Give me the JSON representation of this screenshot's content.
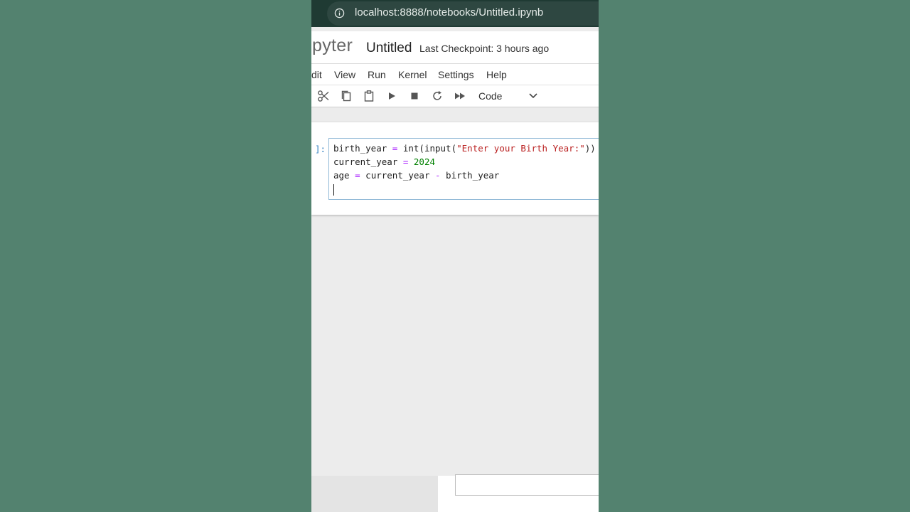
{
  "browser": {
    "url": "localhost:8888/notebooks/Untitled.ipynb"
  },
  "header": {
    "logo_text": "pyter",
    "notebook_title": "Untitled",
    "checkpoint": "Last Checkpoint: 3 hours ago"
  },
  "menu": {
    "items": [
      "dit",
      "View",
      "Run",
      "Kernel",
      "Settings",
      "Help"
    ]
  },
  "toolbar": {
    "cell_type": "Code",
    "icons": [
      "cut-icon",
      "copy-icon",
      "paste-icon",
      "run-icon",
      "stop-icon",
      "restart-icon",
      "fast-forward-icon"
    ]
  },
  "cell": {
    "prompt": "]:",
    "lines": [
      {
        "parts": [
          [
            "var",
            "birth_year "
          ],
          [
            "op",
            "="
          ],
          [
            "var",
            " int(input("
          ],
          [
            "str",
            "\"Enter your Birth Year:\""
          ],
          [
            "var",
            "))"
          ]
        ]
      },
      {
        "parts": [
          [
            "var",
            "current_year "
          ],
          [
            "op",
            "="
          ],
          [
            "var",
            " "
          ],
          [
            "num",
            "2024"
          ]
        ]
      },
      {
        "parts": [
          [
            "var",
            "age "
          ],
          [
            "op",
            "="
          ],
          [
            "var",
            " current_year "
          ],
          [
            "op",
            "-"
          ],
          [
            "var",
            " birth_year"
          ]
        ]
      }
    ]
  },
  "colors": {
    "background": "#53826f",
    "keyword_op": "#aa22ff",
    "string": "#ba2121",
    "number": "#008000",
    "prompt": "#307fc1"
  }
}
